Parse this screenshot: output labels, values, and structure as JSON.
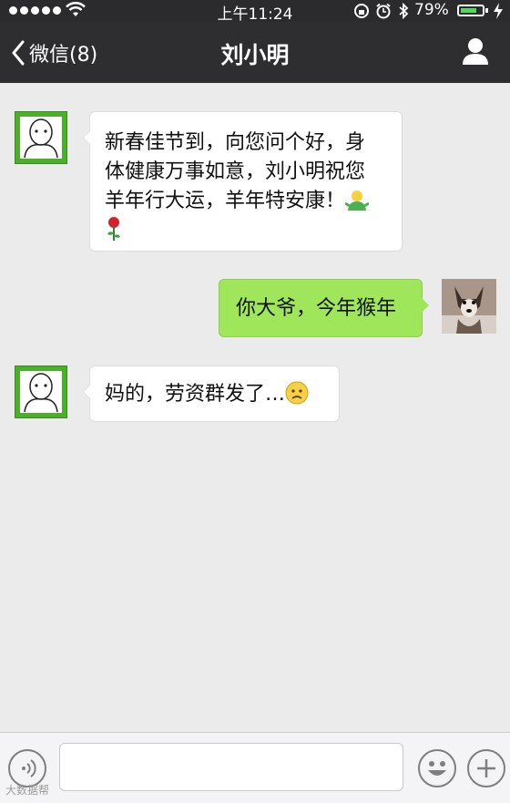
{
  "status_bar": {
    "time": "上午11:24",
    "battery_percent": "79%",
    "battery_level": 0.79,
    "signal_bars": 5
  },
  "nav": {
    "back_label": "微信(8)",
    "title": "刘小明"
  },
  "messages": [
    {
      "side": "left",
      "lines": [
        "新春佳节到，向您问个好，身",
        "体健康万事如意，刘小明祝您",
        "羊年行大运，羊年特安康！"
      ],
      "trailing_emoji_icon": "green-person-emoji",
      "extra_icon": "rose-emoji"
    },
    {
      "side": "right",
      "text": "你大爷，今年猴年"
    },
    {
      "side": "left",
      "text": "妈的，劳资群发了…",
      "trailing_emoji_icon": "sad-face-emoji"
    }
  ],
  "input_bar": {
    "placeholder": "",
    "voice_icon": "voice-icon",
    "emoji_icon": "smiley-icon",
    "plus_icon": "plus-icon"
  },
  "watermark": "大数据帮",
  "colors": {
    "nav_bg": "#2e2e30",
    "chat_bg": "#ebebeb",
    "sent_bubble": "#9fe65a",
    "avatar_green": "#4caf2a"
  }
}
